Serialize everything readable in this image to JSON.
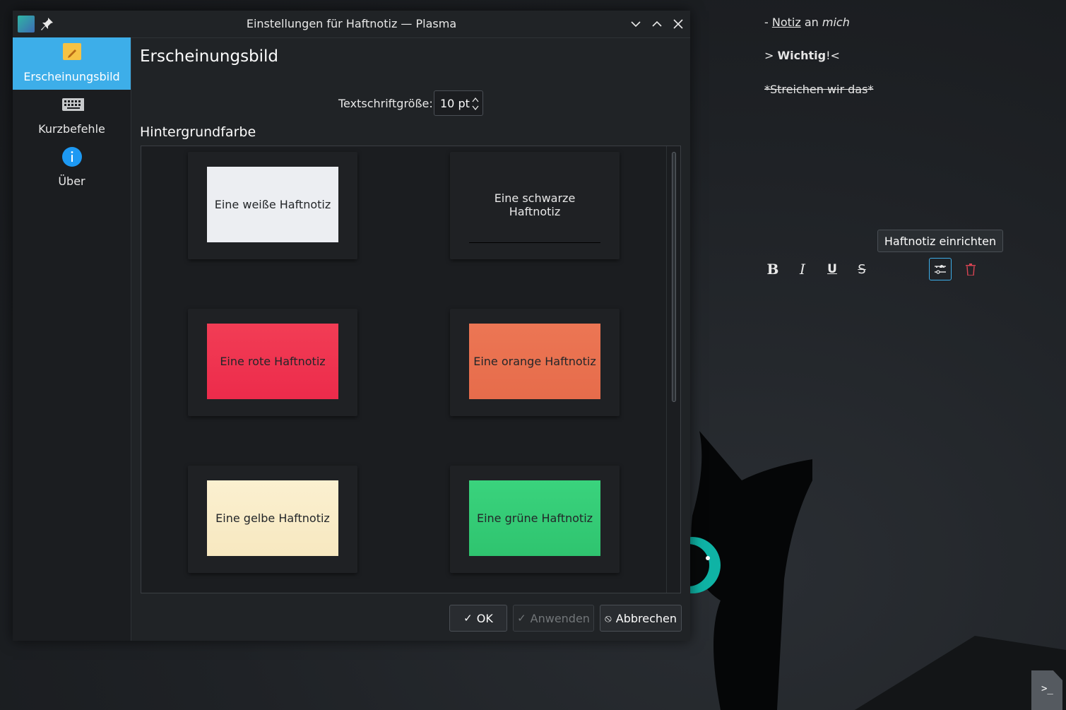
{
  "window": {
    "title": "Einstellungen für Haftnotiz — Plasma"
  },
  "sidebar": {
    "items": [
      {
        "label": "Erscheinungsbild",
        "icon": "sticky-note-icon",
        "active": true
      },
      {
        "label": "Kurzbefehle",
        "icon": "keyboard-icon",
        "active": false
      },
      {
        "label": "Über",
        "icon": "info-icon",
        "active": false
      }
    ]
  },
  "main": {
    "title": "Erscheinungsbild",
    "font_size_label": "Textschriftgröße:",
    "font_size_value": "10 pt",
    "background_label": "Hintergrundfarbe",
    "colors": [
      {
        "label": "Eine weiße Haftnotiz",
        "color": "#eceef2",
        "text_color": "#232629"
      },
      {
        "label": "Eine schwarze Haftnotiz",
        "color": "#1f2124",
        "text_color": "#e8e8e8"
      },
      {
        "label": "Eine rote Haftnotiz",
        "color": "#ef3550",
        "text_color": "#232629"
      },
      {
        "label": "Eine orange Haftnotiz",
        "color": "#e9724f",
        "text_color": "#232629"
      },
      {
        "label": "Eine gelbe Haftnotiz",
        "color": "#f9ecc8",
        "text_color": "#232629"
      },
      {
        "label": "Eine grüne Haftnotiz",
        "color": "#35cd77",
        "text_color": "#232629"
      }
    ]
  },
  "buttons": {
    "ok": "OK",
    "apply": "Anwenden",
    "cancel": "Abbrechen"
  },
  "note": {
    "line1": {
      "prefix": "- ",
      "underlined": "Notiz",
      "middle": " an ",
      "italic": "mich"
    },
    "line2": {
      "prefix": "> ",
      "bold": "Wichtig",
      "suffix": "!<"
    },
    "line3": {
      "strike": "*Streichen wir das*"
    },
    "tooltip": "Haftnotiz einrichten ...",
    "toolbar": [
      "bold-icon",
      "italic-icon",
      "underline-icon",
      "strikethrough-icon",
      "configure-icon",
      "delete-icon"
    ]
  }
}
